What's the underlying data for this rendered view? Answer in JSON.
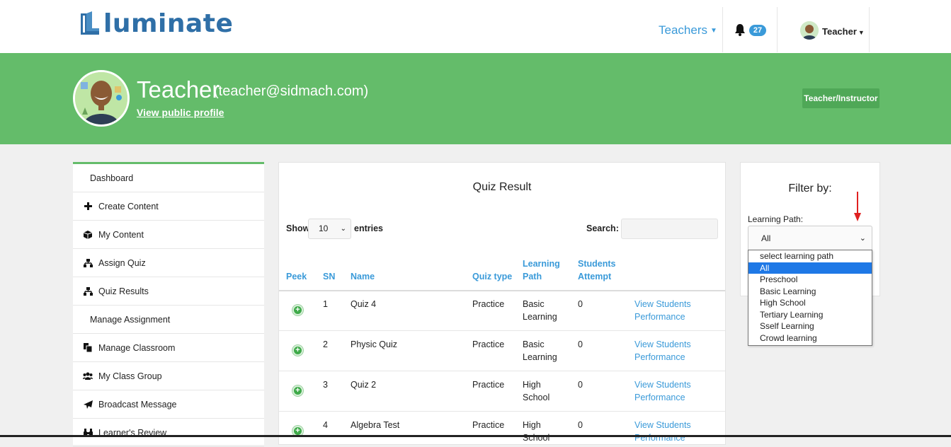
{
  "brand": {
    "name": "luminate",
    "color": "#2f6fa7"
  },
  "topnav": {
    "teachers_label": "Teachers",
    "notifications_count": "27",
    "user_label": "Teacher"
  },
  "profile": {
    "name": "Teacher",
    "email": "(teacher@sidmach.com)",
    "link": "View public profile",
    "role": "Teacher/Instructor",
    "banner_color": "#64bc6a"
  },
  "sidebar": {
    "items": [
      {
        "label": "Dashboard",
        "icon": ""
      },
      {
        "label": "Create Content",
        "icon": "plus-icon"
      },
      {
        "label": "My Content",
        "icon": "cube-icon"
      },
      {
        "label": "Assign Quiz",
        "icon": "sitemap-icon"
      },
      {
        "label": "Quiz Results",
        "icon": "sitemap-icon"
      },
      {
        "label": "Manage Assignment",
        "icon": ""
      },
      {
        "label": "Manage Classroom",
        "icon": "copy-icon"
      },
      {
        "label": "My Class Group",
        "icon": "users-icon"
      },
      {
        "label": "Broadcast Message",
        "icon": "paper-plane-icon"
      },
      {
        "label": "Learner's Review",
        "icon": "binoculars-icon"
      }
    ]
  },
  "quiz": {
    "title": "Quiz Result",
    "show_label": "Show",
    "page_size": "10",
    "entries_label": "entries",
    "search_label": "Search:",
    "columns": {
      "peek": "Peek",
      "sn": "SN",
      "name": "Name",
      "quiz_type": "Quiz type",
      "learning_path_1": "Learning",
      "learning_path_2": "Path",
      "students_1": "Students",
      "students_2": "Attempt"
    },
    "rows": [
      {
        "sn": "1",
        "name": "Quiz 4",
        "type": "Practice",
        "path1": "Basic",
        "path2": "Learning",
        "attempt": "0",
        "action1": "View Students",
        "action2": "Performance"
      },
      {
        "sn": "2",
        "name": "Physic Quiz",
        "type": "Practice",
        "path1": "Basic",
        "path2": "Learning",
        "attempt": "0",
        "action1": "View Students",
        "action2": "Performance"
      },
      {
        "sn": "3",
        "name": "Quiz 2",
        "type": "Practice",
        "path1": "High",
        "path2": "School",
        "attempt": "0",
        "action1": "View Students",
        "action2": "Performance"
      },
      {
        "sn": "4",
        "name": "Algebra Test",
        "type": "Practice",
        "path1": "High",
        "path2": "School",
        "attempt": "0",
        "action1": "View Students",
        "action2": "Performance"
      }
    ]
  },
  "filter": {
    "title": "Filter by:",
    "learning_path_label": "Learning Path:",
    "selected": "All",
    "options": [
      "select learning path",
      "All",
      "Preschool",
      "Basic Learning",
      "High School",
      "Tertiary Learning",
      "Sself Learning",
      "Crowd learning"
    ]
  }
}
